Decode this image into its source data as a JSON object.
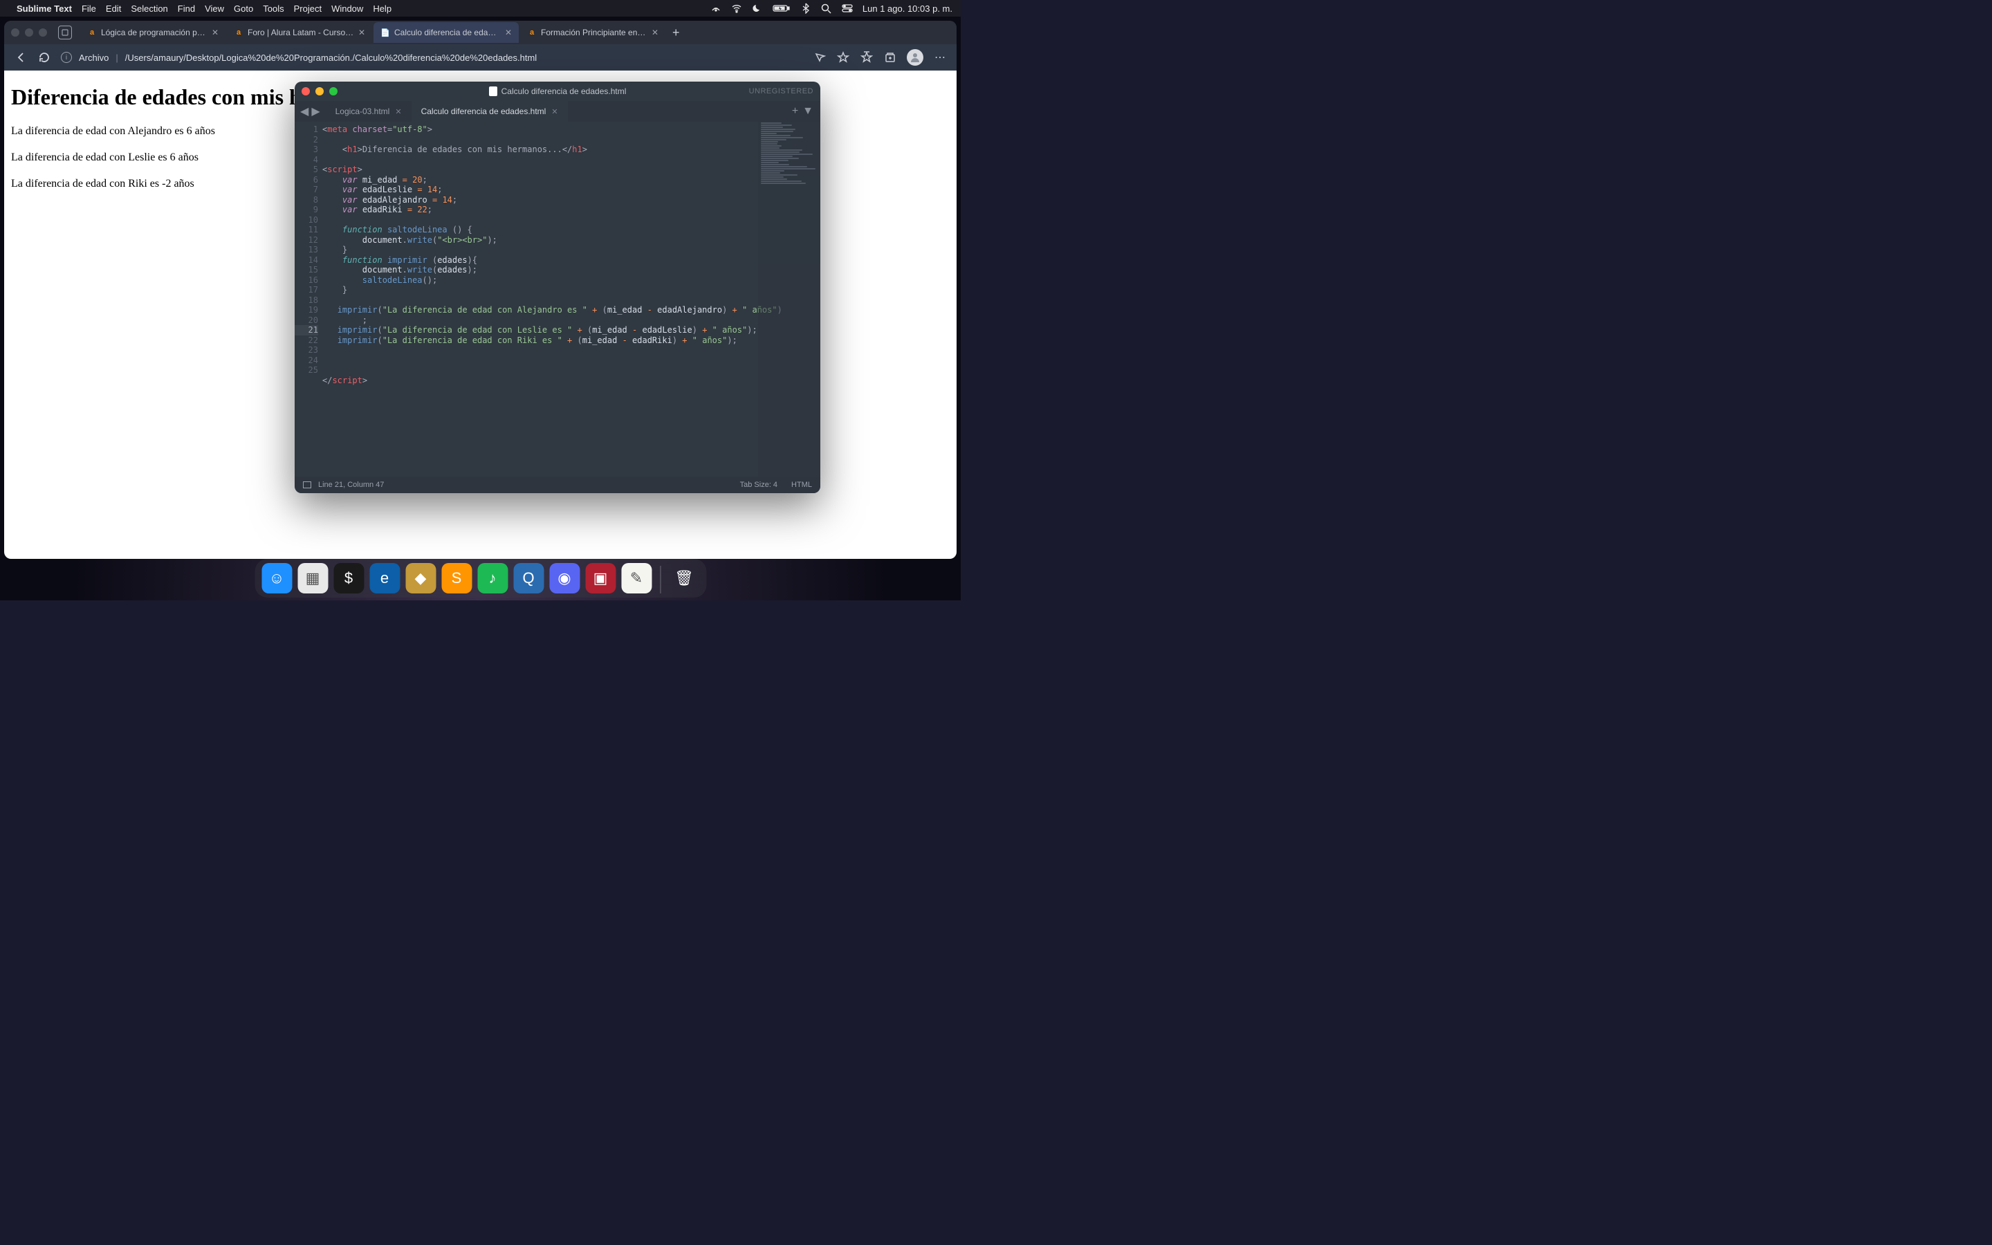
{
  "menubar": {
    "app": "Sublime Text",
    "items": [
      "File",
      "Edit",
      "Selection",
      "Find",
      "View",
      "Goto",
      "Tools",
      "Project",
      "Window",
      "Help"
    ],
    "clock": "Lun 1 ago.  10:03 p. m."
  },
  "browser": {
    "tabs": [
      {
        "label": "Lógica de programación parte",
        "favicon": "a"
      },
      {
        "label": "Foro | Alura Latam - Cursos on",
        "favicon": "a"
      },
      {
        "label": "Calculo diferencia de edades.h",
        "favicon": "📄",
        "active": true
      },
      {
        "label": "Formación Principiante en Prog",
        "favicon": "a"
      }
    ],
    "url_label": "Archivo",
    "url_path": "/Users/amaury/Desktop/Logica%20de%20Programación./Calculo%20diferencia%20de%20edades.html"
  },
  "page": {
    "h1": "Diferencia de edades con mis he",
    "p1": "La diferencia de edad con Alejandro es 6 años",
    "p2": "La diferencia de edad con Leslie es 6 años",
    "p3": "La diferencia de edad con Riki es -2 años"
  },
  "sublime": {
    "title": "Calculo diferencia de edades.html",
    "unregistered": "UNREGISTERED",
    "tabs": [
      {
        "label": "Logica-03.html"
      },
      {
        "label": "Calculo diferencia de edades.html",
        "active": true
      }
    ],
    "status_left": "Line 21, Column 47",
    "status_tab": "Tab Size: 4",
    "status_lang": "HTML",
    "lines": 25,
    "active_line": 21
  },
  "dock": {
    "apps": [
      {
        "name": "finder",
        "bg": "#1e90ff",
        "glyph": "☺"
      },
      {
        "name": "launchpad",
        "bg": "#e8e8e8",
        "glyph": "▦"
      },
      {
        "name": "terminal",
        "bg": "#1a1a1a",
        "glyph": "$"
      },
      {
        "name": "edge",
        "bg": "#0c5fa8",
        "glyph": "e"
      },
      {
        "name": "league",
        "bg": "#c49a3a",
        "glyph": "◆"
      },
      {
        "name": "sublime",
        "bg": "#ff9500",
        "glyph": "S"
      },
      {
        "name": "spotify",
        "bg": "#1db954",
        "glyph": "♪"
      },
      {
        "name": "quicktime",
        "bg": "#2b6cb0",
        "glyph": "Q"
      },
      {
        "name": "discord",
        "bg": "#5865f2",
        "glyph": "◉"
      },
      {
        "name": "game",
        "bg": "#b02030",
        "glyph": "▣"
      },
      {
        "name": "notes",
        "bg": "#f5f5f0",
        "glyph": "✎"
      }
    ],
    "trash_glyph": "🗑"
  }
}
